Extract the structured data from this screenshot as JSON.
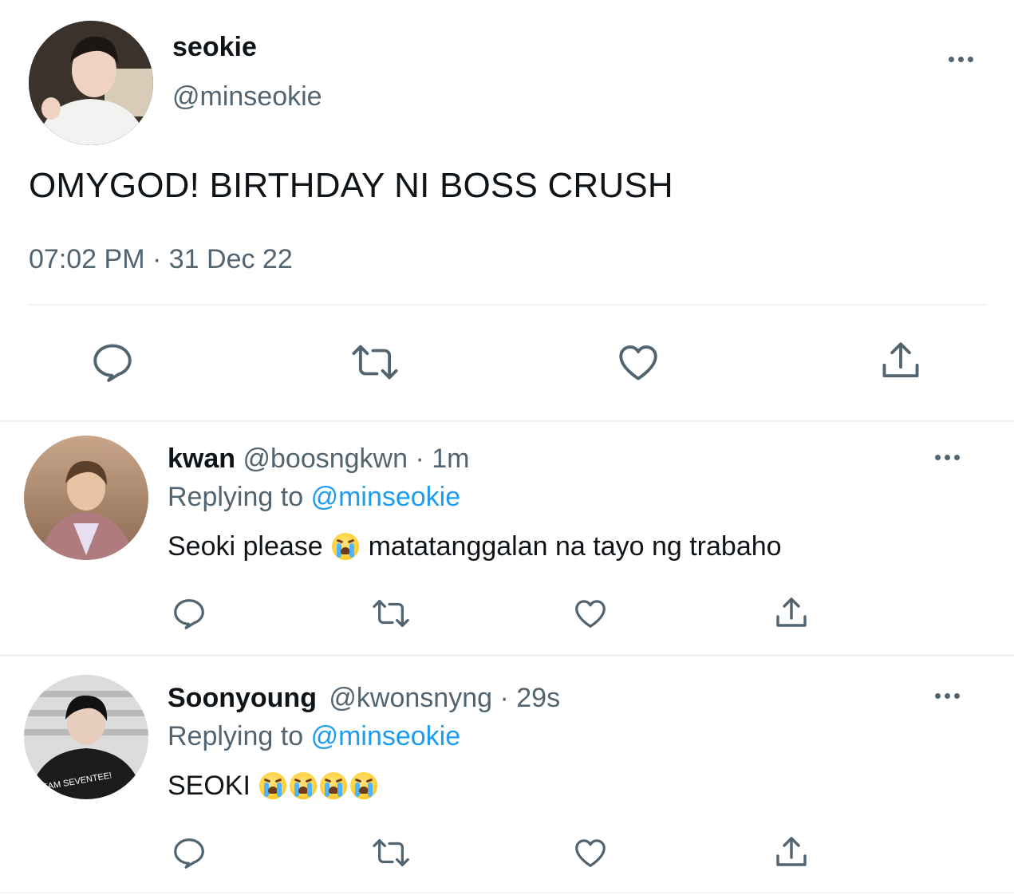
{
  "main_tweet": {
    "display_name": "seokie",
    "handle": "@minseokie",
    "text": "OMYGOD! BIRTHDAY NI BOSS CRUSH",
    "timestamp": "07:02 PM · 31 Dec 22"
  },
  "replies": [
    {
      "display_name": "kwan",
      "handle": "@boosngkwn",
      "time": "· 1m",
      "replying_prefix": "Replying to",
      "replying_handle": "@minseokie",
      "text_before": "Seoki please",
      "text_after": "matatanggalan na tayo ng trabaho"
    },
    {
      "display_name": "Soonyoung",
      "handle": "@kwonsnyng",
      "time": "· 29s",
      "replying_prefix": "Replying to",
      "replying_handle": "@minseokie",
      "text_before": "SEOKI",
      "text_after": ""
    }
  ],
  "avatar_shirt_text": "EAM SEVENTEE!",
  "icons": {
    "reply": "reply-icon",
    "retweet": "retweet-icon",
    "like": "heart-icon",
    "share": "share-icon",
    "more": "more-icon",
    "emoji": "loudly-crying-face-emoji"
  },
  "colors": {
    "text": "#0f1419",
    "muted": "#536471",
    "link": "#1d9bf0",
    "divider": "#eff3f4"
  }
}
